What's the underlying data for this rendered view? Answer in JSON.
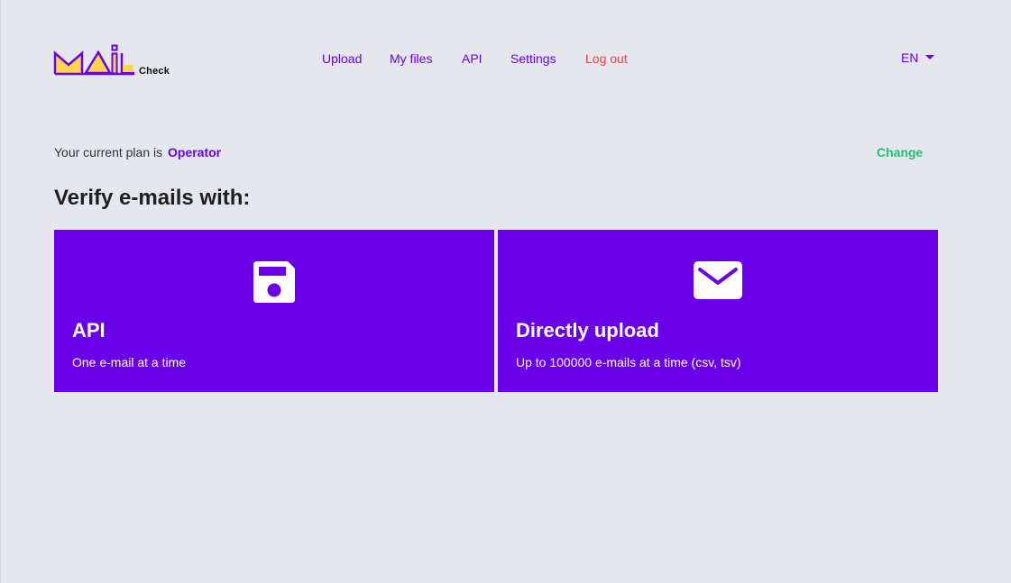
{
  "logo": {
    "check_label": "Check"
  },
  "nav": {
    "items": [
      {
        "label": "Upload"
      },
      {
        "label": "My files"
      },
      {
        "label": "API"
      },
      {
        "label": "Settings"
      },
      {
        "label": "Log out"
      }
    ]
  },
  "language": {
    "selected": "EN"
  },
  "plan": {
    "prefix": "Your current plan is",
    "name": "Operator",
    "change_label": "Change"
  },
  "main": {
    "heading": "Verify e-mails with:",
    "cards": [
      {
        "title": "API",
        "description": "One e-mail at a time",
        "icon": "floppy-disk-icon"
      },
      {
        "title": "Directly upload",
        "description": "Up to 100000 e-mails at a time (csv, tsv)",
        "icon": "envelope-icon"
      }
    ]
  },
  "colors": {
    "background": "#e4e7ed",
    "accent": "#6a00e8",
    "logout": "#f0413f",
    "change": "#1ec471",
    "logo_fill": "#ffd54f"
  }
}
